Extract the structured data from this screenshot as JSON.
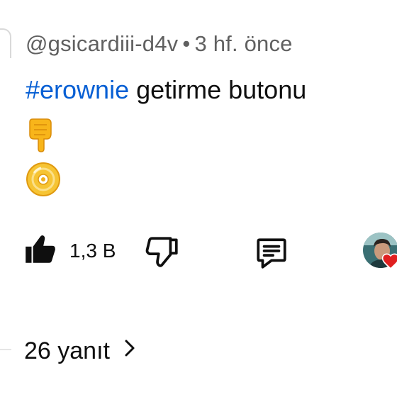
{
  "comment": {
    "author": "@gsicardiii-d4v",
    "separator": "•",
    "time": "3 hf. önce",
    "hashtag": "#erownie",
    "text": " getirme butonu"
  },
  "emojis": [
    "point-down-emoji",
    "dvd-disc-emoji"
  ],
  "actions": {
    "like_count": "1,3 B"
  },
  "replies": {
    "label": "26 yanıt"
  },
  "colors": {
    "link": "#065fd4",
    "secondary_text": "#606060",
    "primary_text": "#0f0f0f",
    "heart": "#e02020"
  }
}
